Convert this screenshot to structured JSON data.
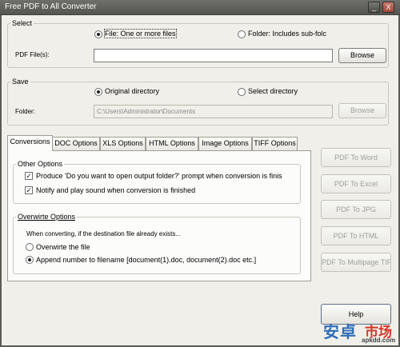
{
  "window": {
    "title": "Free PDF to All Converter",
    "min_glyph": "_",
    "close_glyph": "X"
  },
  "select": {
    "group_label": "Select",
    "file_option": "File:  One or more files",
    "folder_option": "Folder: Includes sub-folc",
    "selected": "file",
    "pdf_files_label": "PDF File(s):",
    "pdf_files_value": "",
    "browse_label": "Browse"
  },
  "save": {
    "group_label": "Save",
    "original_option": "Original directory",
    "select_option": "Select directory",
    "selected": "original",
    "folder_label": "Folder:",
    "folder_value": "C:\\Users\\Administrator\\Documents",
    "browse_label": "Browse"
  },
  "tabs": [
    {
      "label": "Conversions",
      "active": true
    },
    {
      "label": "DOC Options",
      "active": false
    },
    {
      "label": "XLS Options",
      "active": false
    },
    {
      "label": "HTML Options",
      "active": false
    },
    {
      "label": "Image Options",
      "active": false
    },
    {
      "label": "TIFF Options",
      "active": false
    }
  ],
  "other_options": {
    "group_label": "Other Options",
    "prompt_option": "Produce 'Do you want to open output folder?' prompt when conversion is finis",
    "prompt_checked": true,
    "notify_option": "Notify and play sound when conversion is finished",
    "notify_checked": true
  },
  "overwrite_options": {
    "group_label": "Overwirte Options",
    "description": "When converting, if the destination file already exists...",
    "overwrite_option": "Overwirte the file",
    "append_option": "Append number to filename  [document(1).doc, document(2).doc etc.]",
    "selected": "append"
  },
  "actions": {
    "pdf_to_word": "PDF To Word",
    "pdf_to_excel": "PDF To Excel",
    "pdf_to_jpg": "PDF To JPG",
    "pdf_to_html": "PDF To HTML",
    "pdf_to_tiff": "PDF To Multipage TIFF",
    "help": "Help"
  },
  "watermark": {
    "text_blue": "安卓",
    "text_red": "市场",
    "url": "apkdd.com"
  }
}
